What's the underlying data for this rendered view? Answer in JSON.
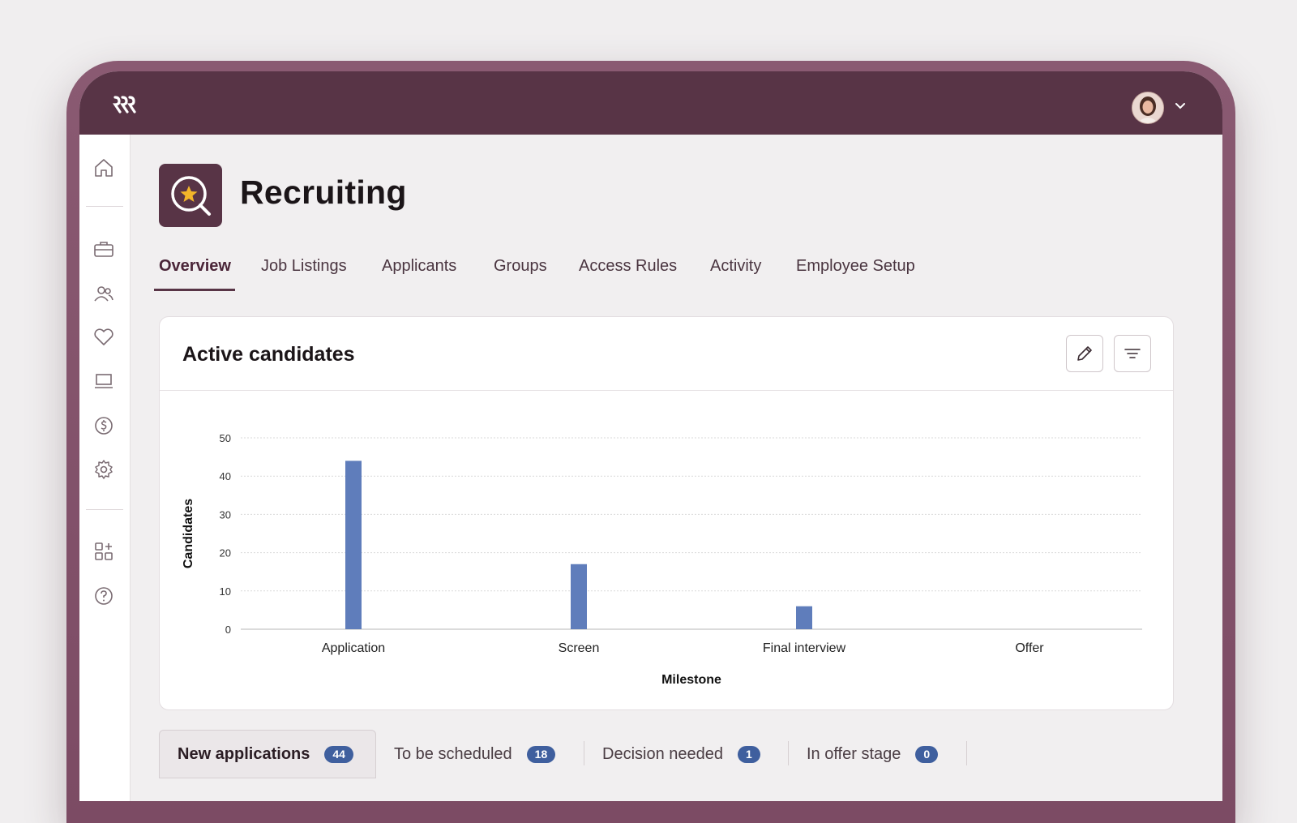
{
  "app": {
    "title": "Recruiting"
  },
  "tabs": [
    "Overview",
    "Job Listings",
    "Applicants",
    "Groups",
    "Access Rules",
    "Activity",
    "Employee Setup"
  ],
  "active_tab": "Overview",
  "card": {
    "title": "Active candidates"
  },
  "chart_data": {
    "type": "bar",
    "categories": [
      "Application",
      "Screen",
      "Final interview",
      "Offer"
    ],
    "values": [
      44,
      17,
      6,
      0
    ],
    "xlabel": "Milestone",
    "ylabel": "Candidates",
    "ylim": [
      0,
      50
    ],
    "yticks": [
      "0",
      "10",
      "20",
      "30",
      "40",
      "50"
    ],
    "grid": true,
    "color": "#5f7dbb"
  },
  "status_tabs": [
    {
      "label": "New applications",
      "count": "44"
    },
    {
      "label": "To be scheduled",
      "count": "18"
    },
    {
      "label": "Decision needed",
      "count": "1"
    },
    {
      "label": "In offer stage",
      "count": "0"
    }
  ],
  "colors": {
    "brand": "#583446",
    "accent": "#3f5f9e"
  }
}
